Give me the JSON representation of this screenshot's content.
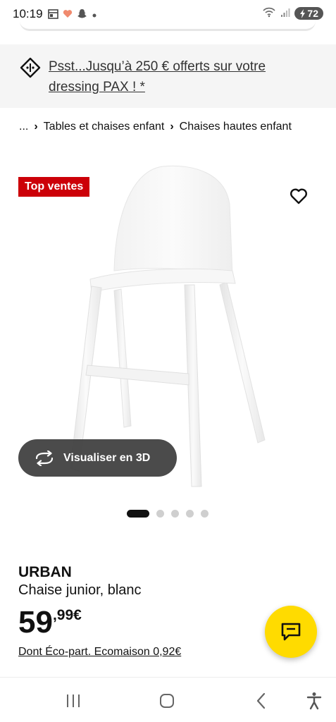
{
  "status_bar": {
    "time": "10:19",
    "battery": "72",
    "icons": [
      "calendar-icon",
      "heart-app-icon",
      "snapchat-icon",
      "dot-icon",
      "wifi-icon",
      "signal-icon",
      "battery-icon"
    ]
  },
  "promo": {
    "text": "Psst...Jusqu’à 250 € offerts sur votre dressing PAX ! *",
    "icon": "price-tag-icon"
  },
  "breadcrumb": {
    "ellipsis": "...",
    "items": [
      "Tables et chaises enfant",
      "Chaises hautes enfant"
    ],
    "separator": "›"
  },
  "product": {
    "badge": "Top ventes",
    "visualize_label": "Visualiser en 3D",
    "name": "URBAN",
    "description": "Chaise junior, blanc",
    "price_int": "59",
    "price_dec": ",99€",
    "ecopart": "Dont Éco-part. Ecomaison 0,92€",
    "image_count": 5,
    "active_image": 1
  },
  "colors": {
    "badge": "#cc0008",
    "chat": "#ffdb00",
    "promo_bg": "#f5f5f5"
  }
}
